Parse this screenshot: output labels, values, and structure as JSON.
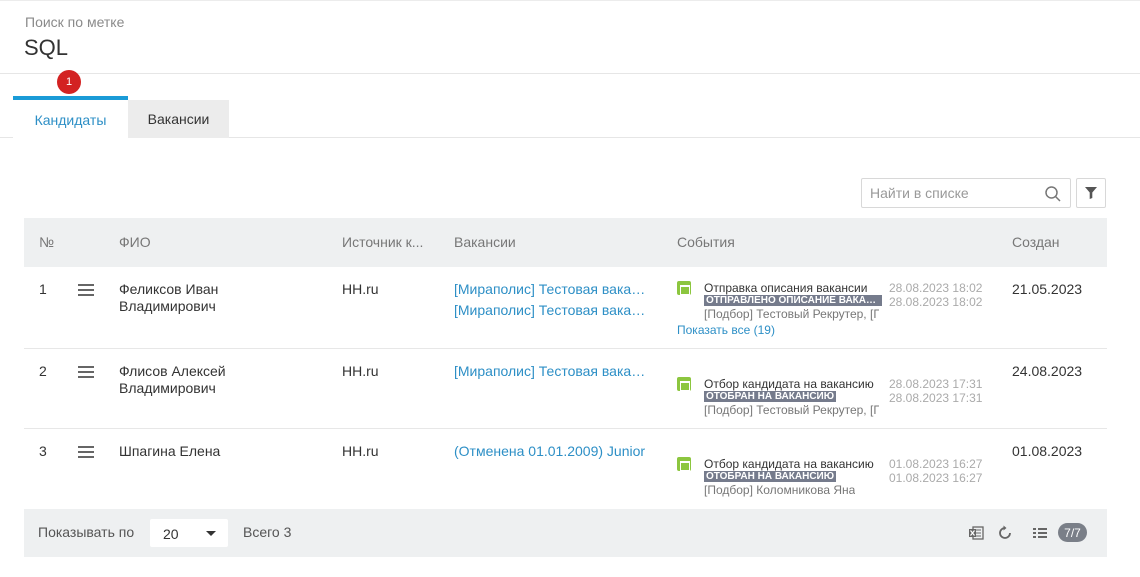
{
  "header": {
    "subtitle": "Поиск по метке",
    "title": "SQL"
  },
  "tabs": [
    {
      "label": "Кандидаты",
      "active": true,
      "badge": "1"
    },
    {
      "label": "Вакансии",
      "active": false
    }
  ],
  "search": {
    "placeholder": "Найти в списке",
    "value": ""
  },
  "table": {
    "columns": [
      "№",
      "ФИО",
      "Источник к...",
      "Вакансии",
      "События",
      "Создан"
    ],
    "rows": [
      {
        "num": "1",
        "fio": "Феликсов Иван Владимирович",
        "source": "HH.ru",
        "vacancies": [
          "[Мираполис] Тестовая вакансия",
          "[Мираполис] Тестовая вакансия"
        ],
        "event": {
          "title": "Отправка описания вакансии",
          "status": "ОТПРАВЛЕНО ОПИСАНИЕ ВАКАНСИИ",
          "who": "[Подбор] Тестовый Рекрутер, [Подбор]",
          "date1": "28.08.2023 18:02",
          "date2": "28.08.2023 18:02"
        },
        "show_all": "Показать все (19)",
        "created": "21.05.2023"
      },
      {
        "num": "2",
        "fio": "Флисов Алексей Владимирович",
        "source": "HH.ru",
        "vacancies": [
          "[Мираполис] Тестовая вакансия"
        ],
        "event": {
          "title": "Отбор кандидата на вакансию",
          "status": "ОТОБРАН НА ВАКАНСИЮ",
          "who": "[Подбор] Тестовый Рекрутер, [Подбор]",
          "date1": "28.08.2023 17:31",
          "date2": "28.08.2023 17:31"
        },
        "created": "24.08.2023"
      },
      {
        "num": "3",
        "fio": "Шпагина Елена",
        "source": "HH.ru",
        "vacancies": [
          "(Отменена 01.01.2009) Junior"
        ],
        "event": {
          "title": "Отбор кандидата на вакансию",
          "status": "ОТОБРАН НА ВАКАНСИЮ",
          "who": "[Подбор] Коломникова Яна",
          "date1": "01.08.2023 16:27",
          "date2": "01.08.2023 16:27"
        },
        "created": "01.08.2023"
      }
    ]
  },
  "footer": {
    "page_size_label": "Показывать по",
    "page_size": "20",
    "total": "Всего 3",
    "columns_count": "7/7"
  },
  "colors": {
    "accent": "#1a9bd7",
    "link": "#2d8fc6",
    "badge": "#d32222",
    "event_icon": "#8cc63f",
    "status_badge": "#757b8c"
  }
}
